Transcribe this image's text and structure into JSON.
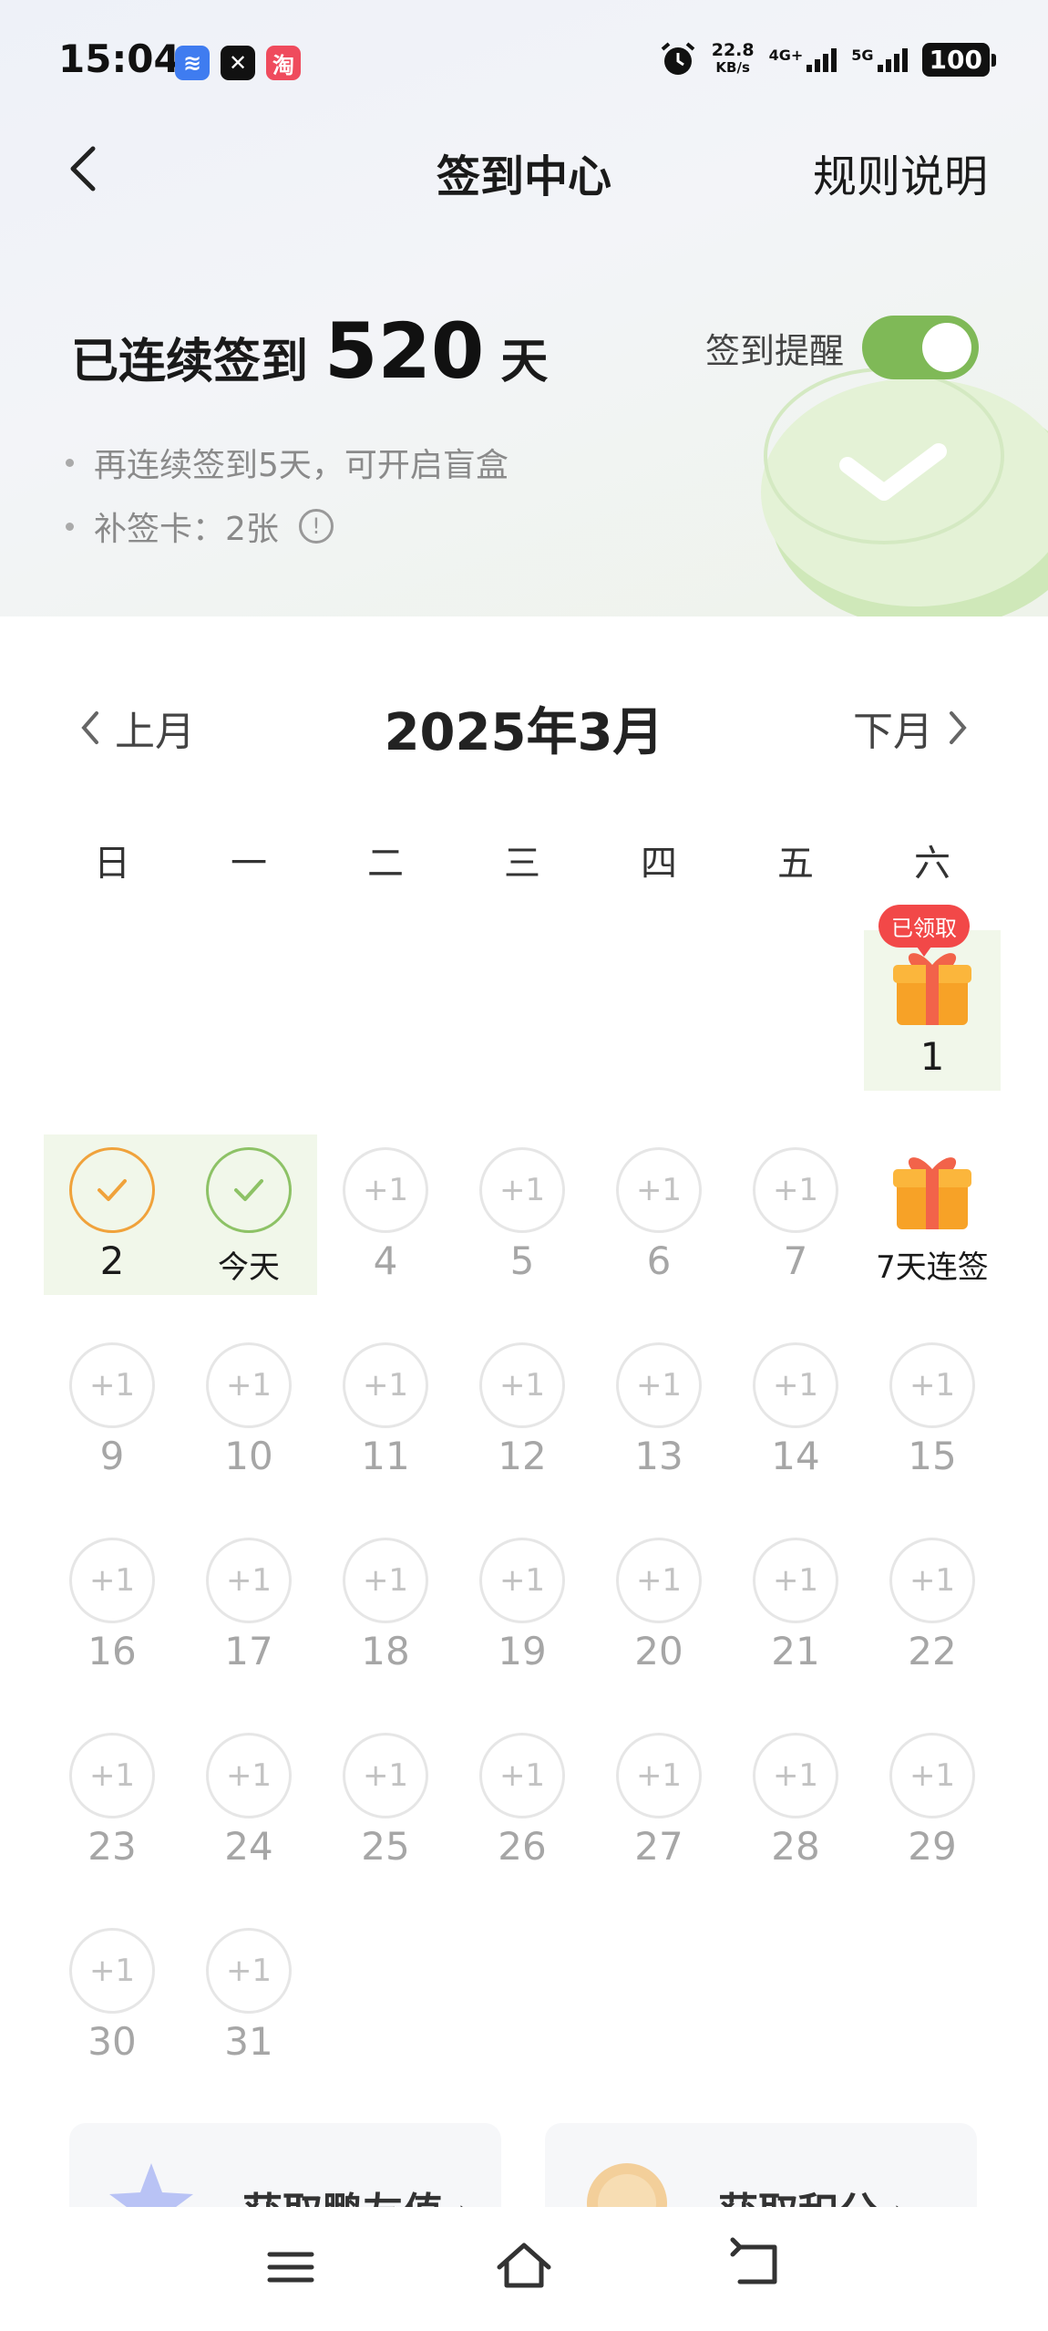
{
  "status_bar": {
    "time": "15:04",
    "app_icons": [
      "wifi-app",
      "capcut-app",
      "taobao-app"
    ],
    "app_glyphs": [
      "≋",
      "✕",
      "淘"
    ],
    "speed_value": "22.8",
    "speed_unit": "KB/s",
    "net1": "4G+",
    "net2": "5G",
    "battery": "100"
  },
  "nav": {
    "title": "签到中心",
    "rules": "规则说明"
  },
  "streak": {
    "prefix": "已连续签到",
    "days": "520",
    "suffix": "天"
  },
  "reminder": {
    "label": "签到提醒",
    "enabled": true
  },
  "tips": [
    "再连续签到5天，可开启盲盒",
    "补签卡：2张"
  ],
  "tip_info_glyph": "!",
  "calendar": {
    "prev": "上月",
    "next": "下月",
    "title": "2025年3月",
    "weekdays": [
      "日",
      "一",
      "二",
      "三",
      "四",
      "五",
      "六"
    ],
    "plus_label": "+1",
    "claimed_badge": "已领取",
    "today_label": "今天",
    "streak_gift_label": "7天连签",
    "days": [
      {
        "label": "1",
        "state": "gift-claimed"
      },
      {
        "label": "2",
        "state": "signed-orange"
      },
      {
        "label": "今天",
        "state": "signed-today"
      },
      {
        "label": "4",
        "state": "plus"
      },
      {
        "label": "5",
        "state": "plus"
      },
      {
        "label": "6",
        "state": "plus"
      },
      {
        "label": "7",
        "state": "plus"
      },
      {
        "label": "7天连签",
        "state": "gift"
      },
      {
        "label": "9",
        "state": "plus"
      },
      {
        "label": "10",
        "state": "plus"
      },
      {
        "label": "11",
        "state": "plus"
      },
      {
        "label": "12",
        "state": "plus"
      },
      {
        "label": "13",
        "state": "plus"
      },
      {
        "label": "14",
        "state": "plus"
      },
      {
        "label": "15",
        "state": "plus"
      },
      {
        "label": "16",
        "state": "plus"
      },
      {
        "label": "17",
        "state": "plus"
      },
      {
        "label": "18",
        "state": "plus"
      },
      {
        "label": "19",
        "state": "plus"
      },
      {
        "label": "20",
        "state": "plus"
      },
      {
        "label": "21",
        "state": "plus"
      },
      {
        "label": "22",
        "state": "plus"
      },
      {
        "label": "23",
        "state": "plus"
      },
      {
        "label": "24",
        "state": "plus"
      },
      {
        "label": "25",
        "state": "plus"
      },
      {
        "label": "26",
        "state": "plus"
      },
      {
        "label": "27",
        "state": "plus"
      },
      {
        "label": "28",
        "state": "plus"
      },
      {
        "label": "29",
        "state": "plus"
      },
      {
        "label": "30",
        "state": "plus"
      },
      {
        "label": "31",
        "state": "plus"
      }
    ]
  },
  "bottom_cards": [
    {
      "text": "获取鹏友值 ›",
      "icon": "star-icon"
    },
    {
      "text": "获取积分 ›",
      "icon": "coin-icon"
    }
  ],
  "colors": {
    "toggle_on": "#7fb957",
    "signed_bg": "#f1f7ea",
    "orange": "#f0a23b",
    "green": "#8dc266",
    "badge_red": "#f24848",
    "gift_orange": "#f7a227"
  }
}
